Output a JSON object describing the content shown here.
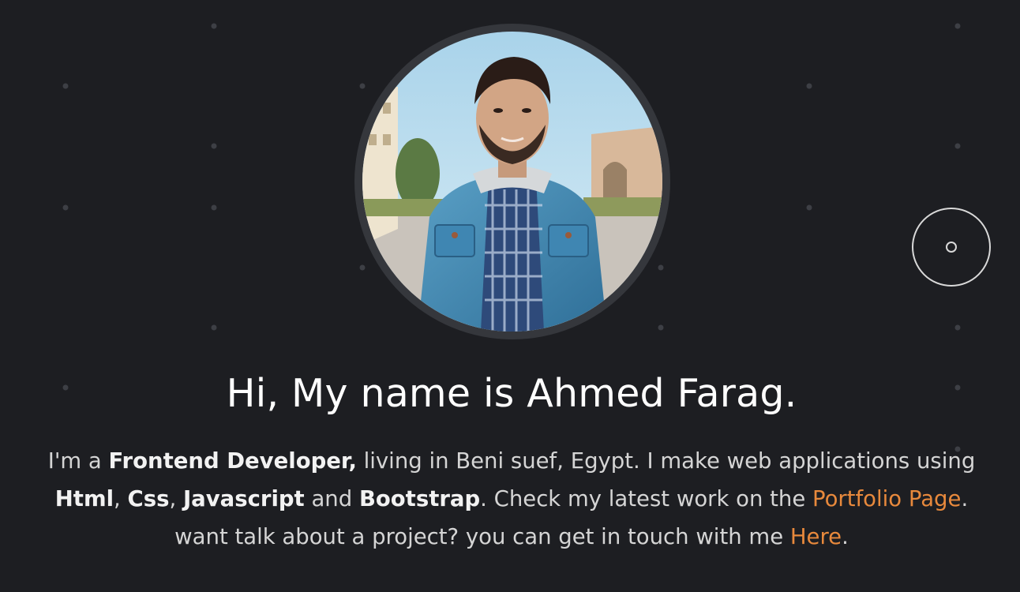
{
  "hero": {
    "headline": "Hi, My name is Ahmed Farag.",
    "bio": {
      "t1": "I'm a ",
      "role": "Frontend Developer,",
      "t2": " living in Beni suef, Egypt. I make web applications using ",
      "skill1": "Html",
      "sep1": ", ",
      "skill2": "Css",
      "sep2": ", ",
      "skill3": "Javascript",
      "sep3": " and ",
      "skill4": "Bootstrap",
      "t3": ". Check my latest work on the ",
      "portfolio_link": "Portfolio Page",
      "t4": ". want talk about a project? you can get in touch with me ",
      "contact_link": "Here",
      "t5": "."
    }
  },
  "colors": {
    "background": "#1d1e22",
    "accent": "#e8893c",
    "heading": "#ffffff",
    "text": "#d5d5d5",
    "avatar_ring": "#35373c",
    "dots": "#3d3f45"
  },
  "icons": {
    "cursor": "cursor-ring-icon"
  }
}
